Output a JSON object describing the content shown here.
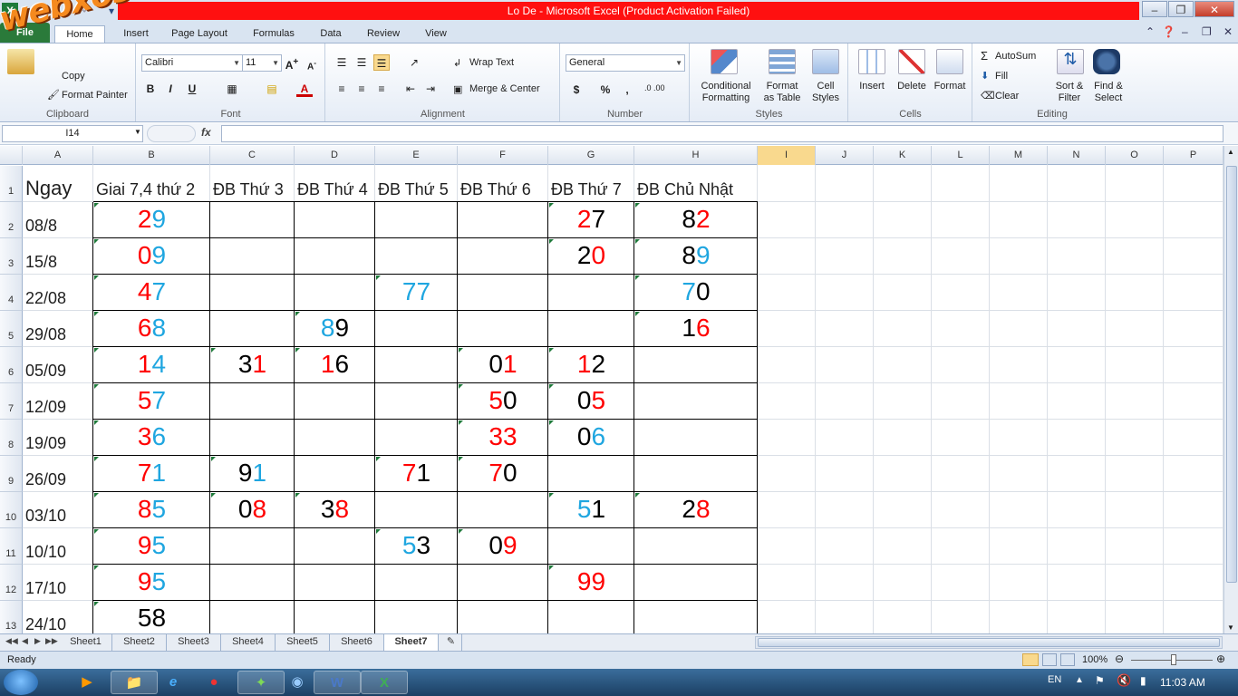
{
  "window": {
    "title": "Lo De  -  Microsoft Excel (Product Activation Failed)"
  },
  "watermark": "webxoso.net",
  "ribbon": {
    "tabs": [
      "File",
      "Home",
      "Insert",
      "Page Layout",
      "Formulas",
      "Data",
      "Review",
      "View"
    ],
    "clipboard": {
      "label": "Clipboard",
      "paste": "Paste",
      "copy": "Copy",
      "format_painter": "Format Painter"
    },
    "font": {
      "label": "Font",
      "name": "Calibri",
      "size": "11",
      "bold": "B",
      "italic": "I",
      "underline": "U"
    },
    "alignment": {
      "label": "Alignment",
      "wrap_text": "Wrap Text",
      "merge_center": "Merge & Center"
    },
    "number": {
      "label": "Number",
      "format": "General",
      "currency": "$",
      "percent": "%",
      "comma": ",",
      "inc_dec": ".0 .00"
    },
    "styles": {
      "label": "Styles",
      "conditional": "Conditional",
      "conditional2": "Formatting",
      "format_as": "Format",
      "format_as2": "as Table",
      "cell_styles": "Cell",
      "cell_styles2": "Styles"
    },
    "cells": {
      "label": "Cells",
      "insert": "Insert",
      "delete": "Delete",
      "format": "Format"
    },
    "editing": {
      "label": "Editing",
      "autosum": "AutoSum",
      "fill": "Fill",
      "clear": "Clear",
      "sort": "Sort &",
      "sort2": "Filter",
      "find": "Find &",
      "find2": "Select"
    }
  },
  "formula_bar": {
    "name_box": "I14",
    "fx": "fx",
    "content": ""
  },
  "grid": {
    "columns": [
      "A",
      "B",
      "C",
      "D",
      "E",
      "F",
      "G",
      "H",
      "I",
      "J",
      "K",
      "L",
      "M",
      "N",
      "O",
      "P"
    ],
    "active_column": "I",
    "rows": [
      "1",
      "2",
      "3",
      "4",
      "5",
      "6",
      "7",
      "8",
      "9",
      "10",
      "11",
      "12",
      "13"
    ],
    "headers": [
      "Ngay",
      "Giai 7,4 thứ 2",
      "ĐB Thứ 3",
      "ĐB Thứ 4",
      "ĐB Thứ 5",
      "ĐB Thứ 6",
      "ĐB Thứ 7",
      "ĐB Chủ Nhật"
    ],
    "dates": [
      "08/8",
      "15/8",
      "22/08",
      "29/08",
      "05/09",
      "12/09",
      "19/09",
      "26/09",
      "03/10",
      "10/10",
      "17/10",
      "24/10"
    ],
    "colors": {
      "red": "#ff0000",
      "blue": "#1fa6e0",
      "black": "#000000"
    },
    "data": [
      {
        "row": 2,
        "col": "B",
        "d1": "2",
        "c1": "red",
        "d2": "9",
        "c2": "blue"
      },
      {
        "row": 2,
        "col": "G",
        "d1": "2",
        "c1": "red",
        "d2": "7",
        "c2": "black"
      },
      {
        "row": 2,
        "col": "H",
        "d1": "8",
        "c1": "black",
        "d2": "2",
        "c2": "red"
      },
      {
        "row": 3,
        "col": "B",
        "d1": "0",
        "c1": "red",
        "d2": "9",
        "c2": "blue"
      },
      {
        "row": 3,
        "col": "G",
        "d1": "2",
        "c1": "black",
        "d2": "0",
        "c2": "red"
      },
      {
        "row": 3,
        "col": "H",
        "d1": "8",
        "c1": "black",
        "d2": "9",
        "c2": "blue"
      },
      {
        "row": 4,
        "col": "B",
        "d1": "4",
        "c1": "red",
        "d2": "7",
        "c2": "blue"
      },
      {
        "row": 4,
        "col": "E",
        "d1": "7",
        "c1": "blue",
        "d2": "7",
        "c2": "blue"
      },
      {
        "row": 4,
        "col": "H",
        "d1": "7",
        "c1": "blue",
        "d2": "0",
        "c2": "black"
      },
      {
        "row": 5,
        "col": "B",
        "d1": "6",
        "c1": "red",
        "d2": "8",
        "c2": "blue"
      },
      {
        "row": 5,
        "col": "D",
        "d1": "8",
        "c1": "blue",
        "d2": "9",
        "c2": "black"
      },
      {
        "row": 5,
        "col": "H",
        "d1": "1",
        "c1": "black",
        "d2": "6",
        "c2": "red"
      },
      {
        "row": 6,
        "col": "B",
        "d1": "1",
        "c1": "red",
        "d2": "4",
        "c2": "blue"
      },
      {
        "row": 6,
        "col": "C",
        "d1": "3",
        "c1": "black",
        "d2": "1",
        "c2": "red"
      },
      {
        "row": 6,
        "col": "D",
        "d1": "1",
        "c1": "red",
        "d2": "6",
        "c2": "black"
      },
      {
        "row": 6,
        "col": "F",
        "d1": "0",
        "c1": "black",
        "d2": "1",
        "c2": "red"
      },
      {
        "row": 6,
        "col": "G",
        "d1": "1",
        "c1": "red",
        "d2": "2",
        "c2": "black"
      },
      {
        "row": 7,
        "col": "B",
        "d1": "5",
        "c1": "red",
        "d2": "7",
        "c2": "blue"
      },
      {
        "row": 7,
        "col": "F",
        "d1": "5",
        "c1": "red",
        "d2": "0",
        "c2": "black"
      },
      {
        "row": 7,
        "col": "G",
        "d1": "0",
        "c1": "black",
        "d2": "5",
        "c2": "red"
      },
      {
        "row": 8,
        "col": "B",
        "d1": "3",
        "c1": "red",
        "d2": "6",
        "c2": "blue"
      },
      {
        "row": 8,
        "col": "F",
        "d1": "3",
        "c1": "red",
        "d2": "3",
        "c2": "red"
      },
      {
        "row": 8,
        "col": "G",
        "d1": "0",
        "c1": "black",
        "d2": "6",
        "c2": "blue"
      },
      {
        "row": 9,
        "col": "B",
        "d1": "7",
        "c1": "red",
        "d2": "1",
        "c2": "blue"
      },
      {
        "row": 9,
        "col": "C",
        "d1": "9",
        "c1": "black",
        "d2": "1",
        "c2": "blue"
      },
      {
        "row": 9,
        "col": "E",
        "d1": "7",
        "c1": "red",
        "d2": "1",
        "c2": "black"
      },
      {
        "row": 9,
        "col": "F",
        "d1": "7",
        "c1": "red",
        "d2": "0",
        "c2": "black"
      },
      {
        "row": 10,
        "col": "B",
        "d1": "8",
        "c1": "red",
        "d2": "5",
        "c2": "blue"
      },
      {
        "row": 10,
        "col": "C",
        "d1": "0",
        "c1": "black",
        "d2": "8",
        "c2": "red"
      },
      {
        "row": 10,
        "col": "D",
        "d1": "3",
        "c1": "black",
        "d2": "8",
        "c2": "red"
      },
      {
        "row": 10,
        "col": "G",
        "d1": "5",
        "c1": "blue",
        "d2": "1",
        "c2": "black"
      },
      {
        "row": 10,
        "col": "H",
        "d1": "2",
        "c1": "black",
        "d2": "8",
        "c2": "red"
      },
      {
        "row": 11,
        "col": "B",
        "d1": "9",
        "c1": "red",
        "d2": "5",
        "c2": "blue"
      },
      {
        "row": 11,
        "col": "E",
        "d1": "5",
        "c1": "blue",
        "d2": "3",
        "c2": "black"
      },
      {
        "row": 11,
        "col": "F",
        "d1": "0",
        "c1": "black",
        "d2": "9",
        "c2": "red"
      },
      {
        "row": 12,
        "col": "B",
        "d1": "9",
        "c1": "red",
        "d2": "5",
        "c2": "blue"
      },
      {
        "row": 12,
        "col": "G",
        "d1": "9",
        "c1": "red",
        "d2": "9",
        "c2": "red"
      },
      {
        "row": 13,
        "col": "B",
        "d1": "5",
        "c1": "black",
        "d2": "8",
        "c2": "black"
      }
    ]
  },
  "sheets": {
    "tabs": [
      "Sheet1",
      "Sheet2",
      "Sheet3",
      "Sheet4",
      "Sheet5",
      "Sheet6",
      "Sheet7"
    ],
    "active": "Sheet7"
  },
  "status": {
    "ready": "Ready",
    "zoom": "100%"
  },
  "taskbar": {
    "lang": "EN",
    "clock": "11:03 AM"
  }
}
